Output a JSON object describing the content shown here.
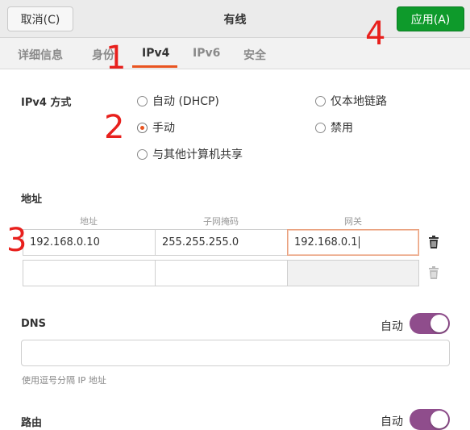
{
  "header": {
    "cancel_label": "取消(C)",
    "title": "有线",
    "apply_label": "应用(A)"
  },
  "tabs": [
    {
      "label": "详细信息"
    },
    {
      "label": "身份"
    },
    {
      "label": "IPv4",
      "active": true
    },
    {
      "label": "IPv6"
    },
    {
      "label": "安全"
    }
  ],
  "ipv4_method": {
    "label": "IPv4 方式",
    "options": [
      {
        "label": "自动 (DHCP)",
        "checked": false
      },
      {
        "label": "仅本地链路",
        "checked": false
      },
      {
        "label": "手动",
        "checked": true
      },
      {
        "label": "禁用",
        "checked": false
      },
      {
        "label": "与其他计算机共享",
        "checked": false
      }
    ]
  },
  "addresses": {
    "label": "地址",
    "columns": [
      "地址",
      "子网掩码",
      "网关"
    ],
    "rows": [
      {
        "address": "192.168.0.10",
        "netmask": "255.255.255.0",
        "gateway": "192.168.0.1"
      },
      {
        "address": "",
        "netmask": "",
        "gateway": ""
      }
    ]
  },
  "dns": {
    "label": "DNS",
    "auto_label": "自动",
    "auto_on": true,
    "value": "",
    "hint": "使用逗号分隔 IP 地址"
  },
  "routes": {
    "label": "路由",
    "auto_label": "自动",
    "auto_on": true
  },
  "annotations": [
    "1",
    "2",
    "3",
    "4"
  ],
  "colors": {
    "accent": "#e95420",
    "apply_button": "#0e9a2b",
    "switch_on": "#8f4d8c",
    "annotation": "#e8201d"
  },
  "icons": [
    "trash-icon"
  ]
}
